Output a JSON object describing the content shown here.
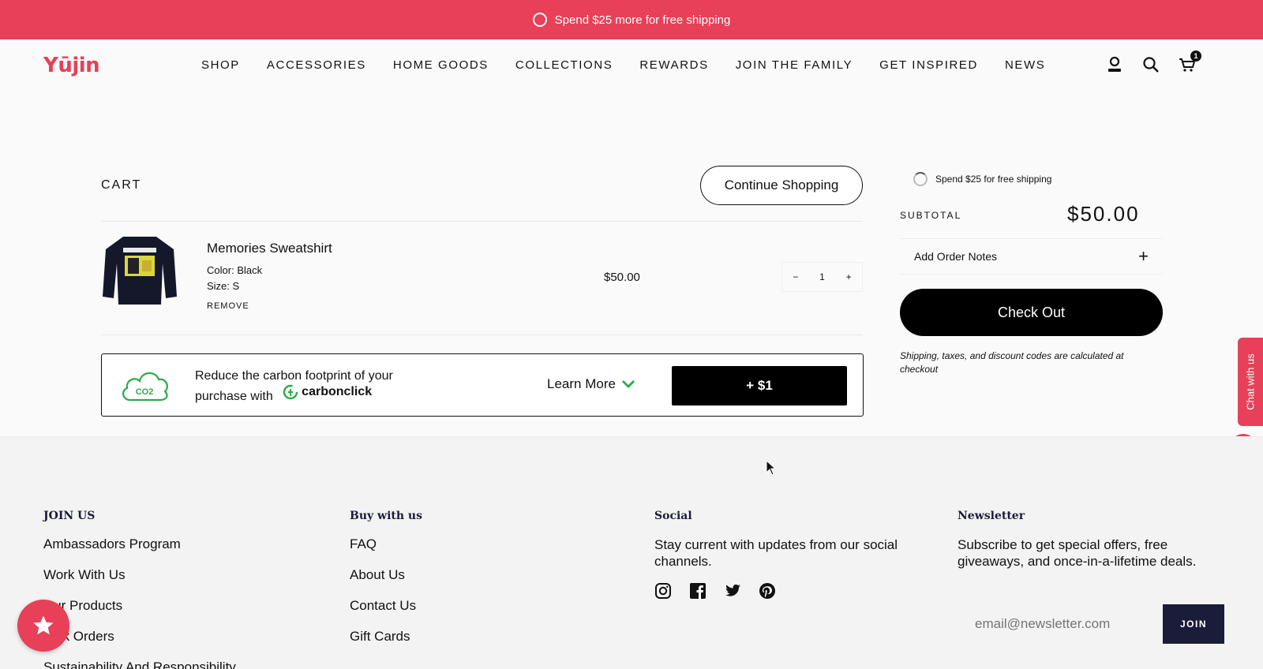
{
  "announcement": {
    "text": "Spend $25 more for free shipping"
  },
  "header": {
    "logo": "Yūjin",
    "nav": [
      "SHOP",
      "ACCESSORIES",
      "HOME GOODS",
      "COLLECTIONS",
      "REWARDS",
      "JOIN THE FAMILY",
      "GET INSPIRED",
      "NEWS"
    ],
    "cart_count": "1",
    "icons": [
      "account-icon",
      "search-icon",
      "cart-icon"
    ]
  },
  "cart": {
    "title": "CART",
    "continue_label": "Continue Shopping",
    "item": {
      "name": "Memories Sweatshirt",
      "color_label": "Color:",
      "color": "Black",
      "size_label": "Size:",
      "size": "S",
      "remove": "REMOVE",
      "price": "$50.00",
      "qty_minus": "−",
      "qty": "1",
      "qty_plus": "+"
    },
    "carbon": {
      "badge": "CO2",
      "line1": "Reduce the carbon footprint of your",
      "line2": "purchase with",
      "brand": "carbonclick",
      "learn_more": "Learn More",
      "add_label": "+ $1"
    }
  },
  "summary": {
    "shipping_msg": "Spend $25 for free shipping",
    "subtotal_label": "SUBTOTAL",
    "subtotal_value": "$50.00",
    "notes_label": "Add Order Notes",
    "checkout_label": "Check Out",
    "note": "Shipping, taxes, and discount codes are calculated at checkout"
  },
  "chat": {
    "label": "Chat with us"
  },
  "footer": {
    "join": {
      "title": "JOIN US",
      "links": [
        "Ambassadors Program",
        "Work With Us",
        "Our Products",
        "Bulk Orders",
        "Sustainability And Responsibility"
      ]
    },
    "buy": {
      "title": "Buy with us",
      "links": [
        "FAQ",
        "About Us",
        "Contact Us",
        "Gift Cards"
      ]
    },
    "social": {
      "title": "Social",
      "text": "Stay current with updates from our social channels.",
      "icons": [
        "instagram-icon",
        "facebook-icon",
        "twitter-icon",
        "pinterest-icon"
      ]
    },
    "newsletter": {
      "title": "Newsletter",
      "text": "Subscribe to get special offers, free giveaways, and once-in-a-lifetime deals.",
      "placeholder": "email@newsletter.com",
      "join_label": "JOIN"
    }
  },
  "colors": {
    "brand": "#e74058",
    "dark": "#1b1b3a",
    "carbon_green": "#2ea84a"
  }
}
